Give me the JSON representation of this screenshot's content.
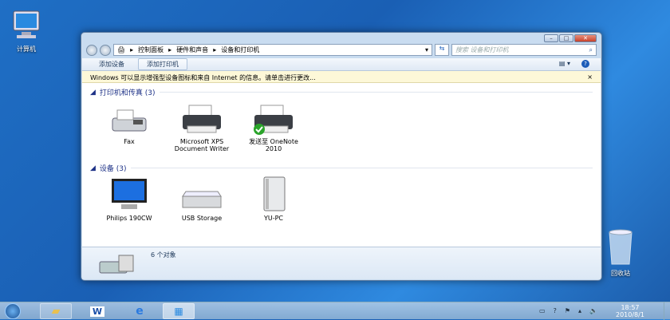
{
  "desktop": {
    "computer_label": "计算机",
    "recycle_label": "回收站"
  },
  "window": {
    "breadcrumb": [
      "控制面板",
      "硬件和声音",
      "设备和打印机"
    ],
    "search_placeholder": "搜索 设备和打印机",
    "toolbar": {
      "add_device": "添加设备",
      "add_printer": "添加打印机"
    },
    "infobar": {
      "text": "Windows 可以显示增强型设备图标和来自 Internet 的信息。请单击进行更改...",
      "close": "×"
    },
    "groups": [
      {
        "title": "打印机和传真 (3)",
        "items": [
          {
            "label": "Fax",
            "icon": "fax-icon"
          },
          {
            "label": "Microsoft XPS Document Writer",
            "icon": "printer-icon"
          },
          {
            "label": "发送至 OneNote 2010",
            "icon": "printer-default-icon"
          }
        ]
      },
      {
        "title": "设备 (3)",
        "items": [
          {
            "label": "Philips 190CW",
            "icon": "monitor-icon"
          },
          {
            "label": "USB Storage",
            "icon": "usb-drive-icon"
          },
          {
            "label": "YU-PC",
            "icon": "computer-tower-icon"
          }
        ]
      }
    ],
    "details": {
      "count": "6 个对象"
    }
  },
  "taskbar": {
    "time": "18:57",
    "date": "2010/8/1"
  }
}
